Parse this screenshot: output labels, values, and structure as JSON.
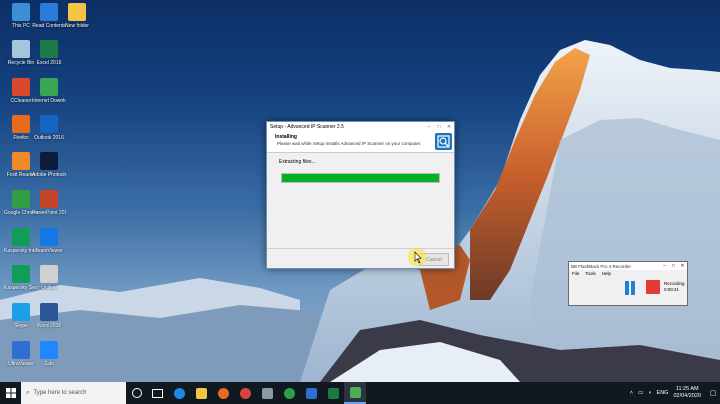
{
  "desktop_icons": [
    {
      "label": "This PC",
      "icon": "monitor-icon",
      "color": "#3a8fd6"
    },
    {
      "label": "Read Contents",
      "icon": "ie-icon",
      "color": "#2b7bd9"
    },
    {
      "label": "New folder",
      "icon": "folder-icon",
      "color": "#f4c542"
    },
    {
      "label": "Recycle Bin",
      "icon": "recycle-bin-icon",
      "color": "#a7c4dd"
    },
    {
      "label": "Excel 2016",
      "icon": "excel-icon",
      "color": "#1e7a45"
    },
    {
      "label": "CCleaner",
      "icon": "ccleaner-icon",
      "color": "#d8492f"
    },
    {
      "label": "Internet Downlo...",
      "icon": "idm-icon",
      "color": "#3aa655"
    },
    {
      "label": "Firefox",
      "icon": "firefox-icon",
      "color": "#e66b1f"
    },
    {
      "label": "Outlook 2016",
      "icon": "outlook-icon",
      "color": "#1565c0"
    },
    {
      "label": "Foxit Reader",
      "icon": "foxit-icon",
      "color": "#f0892a"
    },
    {
      "label": "Adobe Photosho...",
      "icon": "photoshop-icon",
      "color": "#0f1b3a"
    },
    {
      "label": "Google Chrome",
      "icon": "chrome-icon",
      "color": "#2f9e44"
    },
    {
      "label": "PowerPoint 2016",
      "icon": "powerpoint-icon",
      "color": "#c4452a"
    },
    {
      "label": "Kaspersky Internet...",
      "icon": "kaspersky-icon",
      "color": "#0f9d58"
    },
    {
      "label": "TeamViewer",
      "icon": "teamviewer-icon",
      "color": "#1677e6"
    },
    {
      "label": "Kaspersky Secure Co...",
      "icon": "kaspersky-secure-icon",
      "color": "#0f9d58"
    },
    {
      "label": "Unikey",
      "icon": "unikey-icon",
      "color": "#d0d0d0"
    },
    {
      "label": "Skype",
      "icon": "skype-icon",
      "color": "#1aa0e8"
    },
    {
      "label": "Word 2016",
      "icon": "word-icon",
      "color": "#2b5797"
    },
    {
      "label": "UltraViewer",
      "icon": "ultraviewer-icon",
      "color": "#2f6fd1"
    },
    {
      "label": "Zalo",
      "icon": "zalo-icon",
      "color": "#1f87ff"
    }
  ],
  "setup_window": {
    "title": "Setup - Advanced IP Scanner 2.5",
    "minimize": "–",
    "maximize": "□",
    "close": "✕",
    "heading": "Installing",
    "subheading": "Please wait while Setup installs Advanced IP Scanner on your computer.",
    "status": "Extracting files...",
    "progress": 1.0,
    "cancel_label": "Cancel"
  },
  "recorder_window": {
    "title": "BB FlashBack Pro 4 Recorder",
    "menu": [
      "File",
      "Tools",
      "Help"
    ],
    "status_label": "Recording",
    "elapsed": "0:00:41",
    "minimize": "–",
    "maximize": "□",
    "close": "✕"
  },
  "taskbar": {
    "search_placeholder": "Type here to search",
    "language": "ENG",
    "time": "11:25 AM",
    "date": "02/04/2020"
  }
}
